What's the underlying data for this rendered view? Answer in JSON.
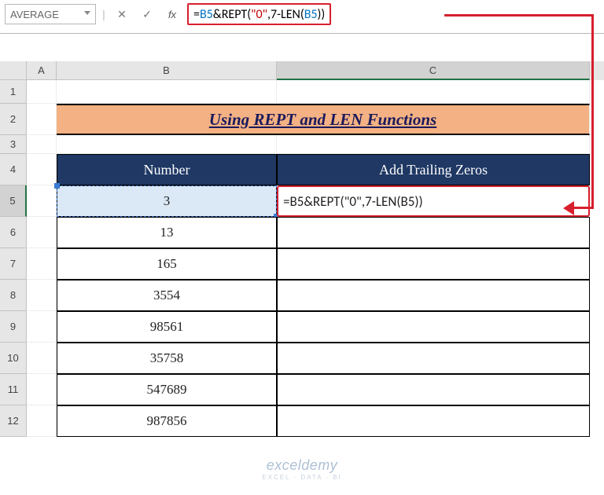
{
  "name_box": "AVERAGE",
  "formula_tokens": {
    "t1": "=",
    "t2": "B5",
    "t3": "&REPT(",
    "t4": "\"0\"",
    "t5": ",7-LEN(",
    "t6": "B5",
    "t7": "))"
  },
  "columns": {
    "a": "A",
    "b": "B",
    "c": "C"
  },
  "rows": [
    "1",
    "2",
    "3",
    "4",
    "5",
    "6",
    "7",
    "8",
    "9",
    "10",
    "11",
    "12"
  ],
  "title": "Using REPT and LEN Functions",
  "headers": {
    "number": "Number",
    "trailing": "Add Trailing Zeros"
  },
  "numbers": [
    "3",
    "13",
    "165",
    "3554",
    "98561",
    "35758",
    "547689",
    "987856"
  ],
  "edit_cell": "=B5&REPT(\"0\",7-LEN(B5))",
  "watermark": {
    "brand": "exceldemy",
    "tag": "EXCEL · DATA · BI"
  }
}
